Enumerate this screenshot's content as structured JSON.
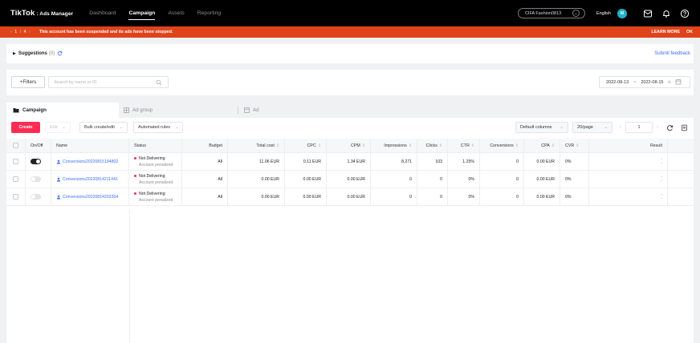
{
  "nav": {
    "brand": "TikTok",
    "brand_sub": ": Ads Manager",
    "links": [
      "Dashboard",
      "Campaign",
      "Assets",
      "Reporting"
    ],
    "account": "CIFA Fashion0813",
    "language": "English",
    "avatar": "M"
  },
  "alert": {
    "current": "1",
    "separator": "/",
    "total": "4",
    "message": "This account has been suspended and its ads have been stopped.",
    "learn_more": "LEARN MORE",
    "ok": "OK"
  },
  "suggestions": {
    "title": "Suggestions",
    "count": "(0)",
    "feedback": "Submit feedback"
  },
  "filters": {
    "button": "+Filters",
    "search_placeholder": "Search by name or ID",
    "date_start": "2022-08-13",
    "date_sep": "~",
    "date_end": "2022-08-15"
  },
  "tabs": [
    "Campaign",
    "Ad group",
    "Ad"
  ],
  "toolbar": {
    "create": "Create",
    "edit": "Edit",
    "bulk": "Bulk create/edit",
    "rules": "Automated rules",
    "default_columns": "Default columns",
    "per_page": "20/page",
    "page": "1"
  },
  "table": {
    "headers": {
      "onoff": "On/Off",
      "name": "Name",
      "status": "Status",
      "budget": "Budget",
      "total_cost": "Total cost",
      "cpc": "CPC",
      "cpm": "CPM",
      "impressions": "Impressions",
      "clicks": "Clicks",
      "ctr": "CTR",
      "conversions": "Conversions",
      "cpa": "CPA",
      "cvr": "CVR",
      "result": "Result"
    },
    "rows": [
      {
        "on": true,
        "name": "Conversions20220815194802",
        "status": "Not Delivering",
        "status_sub": "Account penalized",
        "budget": "All",
        "total_cost": "11.06 EUR",
        "cpc": "0.11 EUR",
        "cpm": "1.34 EUR",
        "impressions": "8,271",
        "clicks": "103",
        "ctr": "1.25%",
        "conversions": "0",
        "cpa": "0.00 EUR",
        "cvr": "0%",
        "result_top": "-",
        "result_bottom": "-"
      },
      {
        "on": false,
        "name": "Conversions20220814211441",
        "status": "Not Delivering",
        "status_sub": "Account penalized",
        "budget": "All",
        "total_cost": "0.00 EUR",
        "cpc": "0.00 EUR",
        "cpm": "0.00 EUR",
        "impressions": "0",
        "clicks": "0",
        "ctr": "0%",
        "conversions": "0",
        "cpa": "0.00 EUR",
        "cvr": "0%",
        "result_top": "-",
        "result_bottom": "-"
      },
      {
        "on": false,
        "name": "Conversions20220814203304",
        "status": "Not Delivering",
        "status_sub": "Account penalized",
        "budget": "All",
        "total_cost": "0.00 EUR",
        "cpc": "0.00 EUR",
        "cpm": "0.00 EUR",
        "impressions": "0",
        "clicks": "0",
        "ctr": "0%",
        "conversions": "0",
        "cpa": "0.00 EUR",
        "cvr": "0%",
        "result_top": "-",
        "result_bottom": "-"
      }
    ]
  }
}
